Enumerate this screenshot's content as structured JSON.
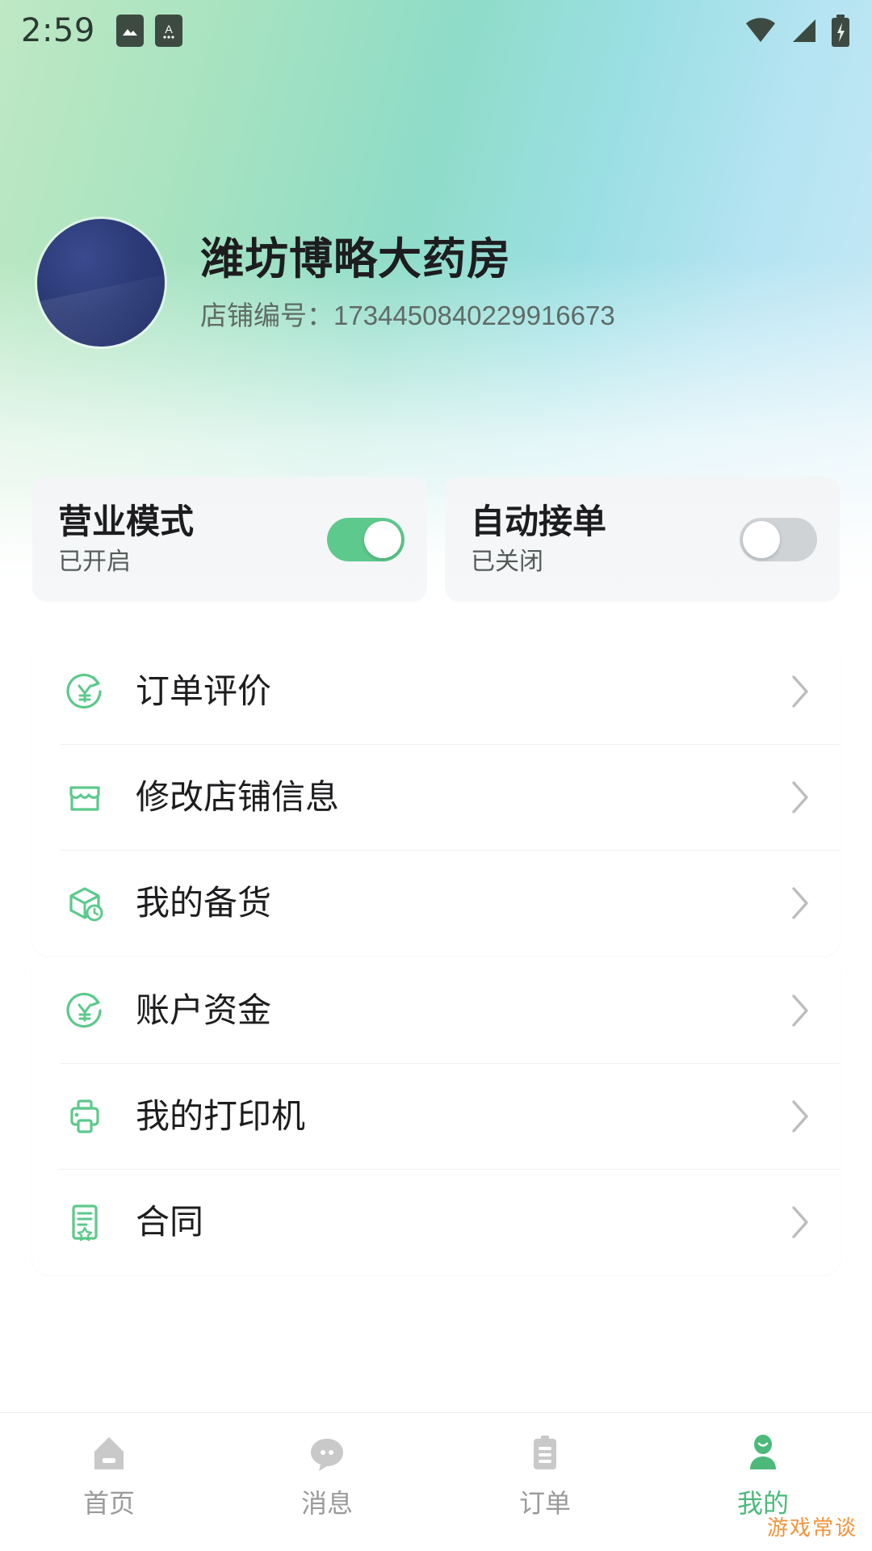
{
  "status_bar": {
    "time": "2:59",
    "left_icons": [
      "image-icon",
      "app-icon"
    ],
    "right_icons": [
      "wifi-icon",
      "signal-icon",
      "battery-charging-icon"
    ]
  },
  "profile": {
    "avatar": "store-avatar",
    "shop_name": "潍坊博略大药房",
    "shop_id_label": "店铺编号：",
    "shop_id_value": "1734450840229916673"
  },
  "toggles": [
    {
      "title": "营业模式",
      "status": "已开启",
      "state": "on",
      "icon": "toggle-switch"
    },
    {
      "title": "自动接单",
      "status": "已关闭",
      "state": "off",
      "icon": "toggle-switch"
    }
  ],
  "menu_groups": [
    {
      "items": [
        {
          "label": "订单评价",
          "icon": "yuan-refresh-icon"
        },
        {
          "label": "修改店铺信息",
          "icon": "storefront-icon"
        },
        {
          "label": "我的备货",
          "icon": "box-clock-icon"
        }
      ]
    },
    {
      "items": [
        {
          "label": "账户资金",
          "icon": "yuan-refresh-icon"
        },
        {
          "label": "我的打印机",
          "icon": "printer-icon"
        },
        {
          "label": "合同",
          "icon": "contract-star-icon"
        }
      ]
    }
  ],
  "bottom_nav": {
    "items": [
      {
        "label": "首页",
        "icon": "home-icon",
        "active": false
      },
      {
        "label": "消息",
        "icon": "message-icon",
        "active": false
      },
      {
        "label": "订单",
        "icon": "clipboard-icon",
        "active": false
      },
      {
        "label": "我的",
        "icon": "person-icon",
        "active": true
      }
    ]
  },
  "watermark": {
    "text": "游戏常谈"
  },
  "colors": {
    "accent_green": "#4cb97a",
    "switch_on": "#5ec98d",
    "switch_off": "#d0d3d6",
    "icon_green": "#5cc98b",
    "text_primary": "#1d1d1f",
    "text_secondary": "#5f6b66",
    "watermark_orange": "#f0953c",
    "avatar_blue": "#2b3a76"
  }
}
